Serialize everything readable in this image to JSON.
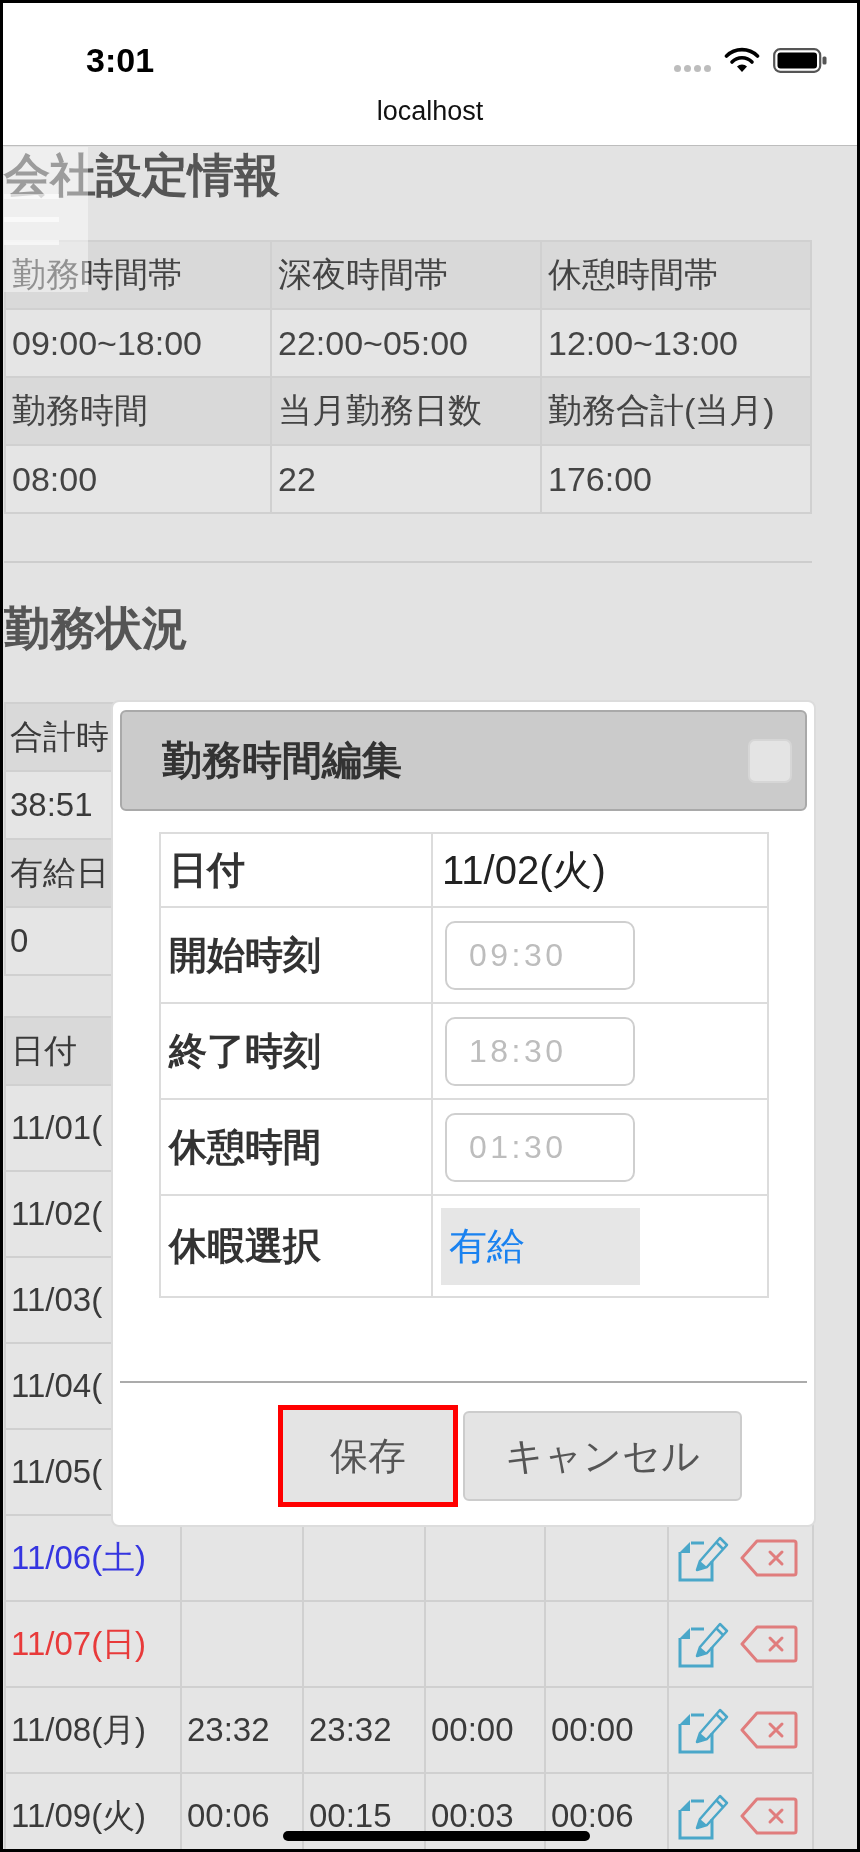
{
  "status_bar": {
    "time": "3:01"
  },
  "browser": {
    "url": "localhost"
  },
  "company_settings": {
    "title": "会社設定情報",
    "rows": [
      {
        "kind": "header",
        "cells": [
          "勤務時間帯",
          "深夜時間帯",
          "休憩時間帯"
        ]
      },
      {
        "kind": "data",
        "cells": [
          "09:00~18:00",
          "22:00~05:00",
          "12:00~13:00"
        ]
      },
      {
        "kind": "header",
        "cells": [
          "勤務時間",
          "当月勤務日数",
          "勤務合計(当月)"
        ]
      },
      {
        "kind": "data",
        "cells": [
          "08:00",
          "22",
          "176:00"
        ]
      }
    ]
  },
  "work_status": {
    "title": "勤務状況",
    "summary": [
      {
        "kind": "header",
        "text": "合計時"
      },
      {
        "kind": "data",
        "text": "38:51"
      },
      {
        "kind": "header",
        "text": "有給日"
      },
      {
        "kind": "data",
        "text": "0"
      }
    ],
    "daily": {
      "columns": [
        "日付"
      ],
      "rows": [
        {
          "kind": "covered",
          "date": "11/01(",
          "color": "#3a3a3a"
        },
        {
          "kind": "covered",
          "date": "11/02(",
          "color": "#3a3a3a"
        },
        {
          "kind": "covered",
          "date": "11/03(",
          "color": "#3a3a3a"
        },
        {
          "kind": "covered",
          "date": "11/04(",
          "color": "#3a3a3a"
        },
        {
          "kind": "covered",
          "date": "11/05(",
          "color": "#3a3a3a"
        },
        {
          "kind": "full",
          "date": "11/06(土)",
          "color": "#3535e0"
        },
        {
          "kind": "full",
          "date": "11/07(日)",
          "color": "#e83a3a"
        },
        {
          "kind": "full",
          "date": "11/08(月)",
          "color": "#3a3a3a",
          "times": [
            "23:32",
            "23:32",
            "00:00",
            "00:00"
          ]
        },
        {
          "kind": "full",
          "date": "11/09(火)",
          "color": "#3a3a3a",
          "times": [
            "00:06",
            "00:15",
            "00:03",
            "00:06"
          ]
        }
      ]
    }
  },
  "dialog": {
    "title": "勤務時間編集",
    "fields": [
      {
        "kind": "text",
        "label": "日付",
        "value": "11/02(火)"
      },
      {
        "kind": "time",
        "label": "開始時刻",
        "placeholder": "09:30"
      },
      {
        "kind": "time",
        "label": "終了時刻",
        "placeholder": "18:30"
      },
      {
        "kind": "time",
        "label": "休憩時間",
        "placeholder": "01:30"
      },
      {
        "kind": "select",
        "label": "休暇選択",
        "value": "有給"
      }
    ],
    "buttons": [
      {
        "label": "保存",
        "highlighted": true
      },
      {
        "label": "キャンセル",
        "highlighted": false
      }
    ]
  }
}
